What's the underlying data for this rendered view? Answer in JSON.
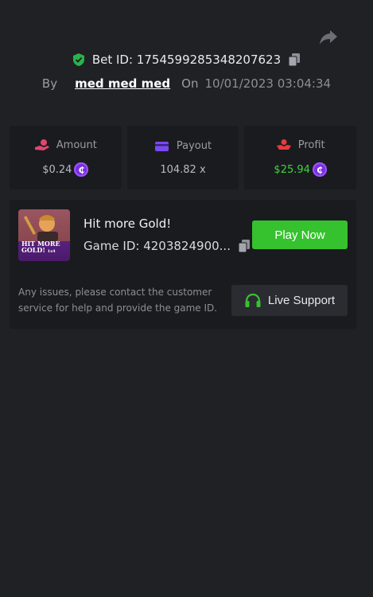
{
  "header": {
    "bet_id": "Bet ID: 1754599285348207623",
    "by_label": "By",
    "username": "med med med",
    "on_label": "On",
    "date": "10/01/2023 03:04:34"
  },
  "stats": [
    {
      "label": "Amount",
      "value": "$0.24",
      "icon": "coin-hand-icon",
      "color": "#e0466e"
    },
    {
      "label": "Payout",
      "value": "104.82 x",
      "icon": "card-icon",
      "color": "#7b49f0"
    },
    {
      "label": "Profit",
      "value": "$25.94",
      "icon": "hand-money-icon",
      "color": "#e53c3c"
    }
  ],
  "coin_symbol": "₵",
  "game": {
    "thumbnail_text_line1": "HIT MORE",
    "thumbnail_text_line2": "GOLD!",
    "thumbnail_text_small": "1x4",
    "title": "Hit more Gold!",
    "id_text": "Game ID: 4203824900...",
    "play_label": "Play Now",
    "issues_text": "Any issues, please contact the customer service for help and provide the game ID.",
    "support_label": "Live Support"
  },
  "colors": {
    "accent_green": "#36c22e",
    "profit_green": "#3ed241",
    "coin_purple": "#7a2fe0",
    "background": "#202125",
    "card": "#1a1b1e"
  }
}
